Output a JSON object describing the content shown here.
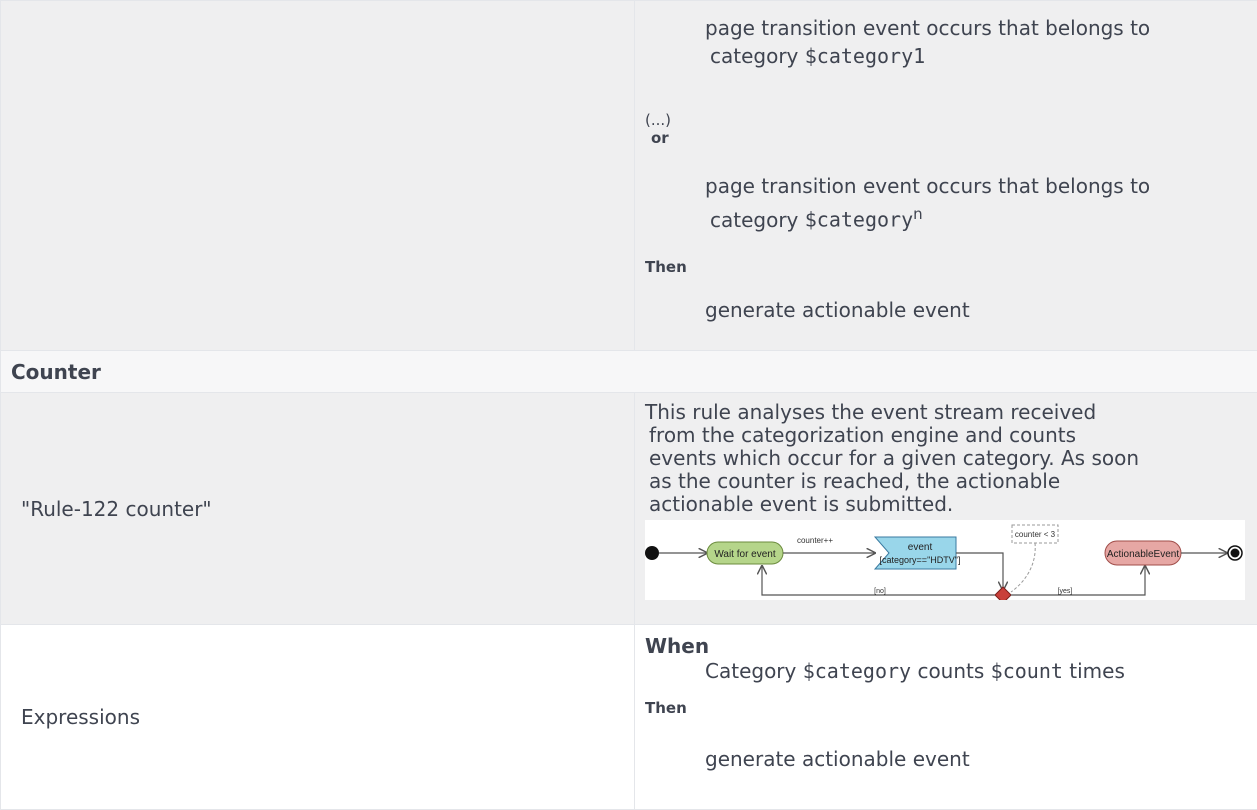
{
  "row1": {
    "line1a": "page transition event occurs that belongs to",
    "line1b_prefix": "category ",
    "line1b_var": "$category1",
    "ellipsis": "(...)",
    "or": "or",
    "line2a": "page transition event occurs that belongs to",
    "line2b_prefix": "category ",
    "line2b_var": "$category",
    "line2b_sup": "n",
    "then": "Then",
    "action": "generate actionable event"
  },
  "section": {
    "title": "Counter"
  },
  "row2": {
    "name": "\"Rule-122 counter\"",
    "description": [
      "This rule analyses the event stream received",
      "from the categorization engine and counts",
      "events which occur for a given category. As soon",
      "as the counter is reached, the actionable",
      "actionable event is submitted."
    ],
    "diagram": {
      "wait_label": "Wait for event",
      "counter_inc": "counter++",
      "event_label": "event",
      "event_cond": "[category==\"HDTV\"]",
      "guard": "counter < 3",
      "actionable": "ActionableEvent",
      "no": "[no]",
      "yes": "[yes]"
    }
  },
  "row3": {
    "label": "Expressions",
    "when": "When",
    "cond_prefix": "Category ",
    "cond_var1": "$category",
    "cond_mid": " counts ",
    "cond_var2": "$count",
    "cond_suffix": " times",
    "then": "Then",
    "action": "generate actionable event"
  },
  "colors": {
    "wait_fill": "#b5d58a",
    "event_fill": "#99d6ea",
    "actionable_fill": "#e6a7a4",
    "decision_fill": "#c9403a"
  }
}
